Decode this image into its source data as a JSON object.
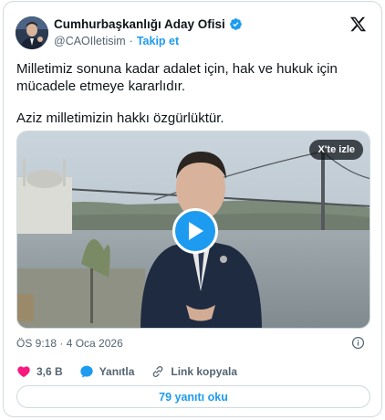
{
  "author": {
    "name": "Cumhurbaşkanlığı Aday Ofisi",
    "handle": "@CAOIletisim",
    "follow_label": "Takip et"
  },
  "tweet": {
    "line1": "Milletimiz sonuna kadar adalet için, hak ve hukuk için mücadele etmeye kararlıdır.",
    "line2": "Aziz milletimizin hakkı özgürlüktür."
  },
  "media": {
    "watch_label": "X'te izle"
  },
  "meta": {
    "timestamp": "ÖS 9:18 · 4 Oca 2026"
  },
  "actions": {
    "likes": "3,6 B",
    "reply_label": "Yanıtla",
    "copy_link_label": "Link kopyala"
  },
  "replies_button": "79 yanıtı oku",
  "colors": {
    "accent": "#1d9bf0",
    "like": "#f91880",
    "text": "#0f1419",
    "muted": "#536471"
  },
  "icons": [
    "x-logo-icon",
    "verified-badge-icon",
    "play-icon",
    "info-icon",
    "heart-icon",
    "reply-bubble-icon",
    "link-icon"
  ]
}
